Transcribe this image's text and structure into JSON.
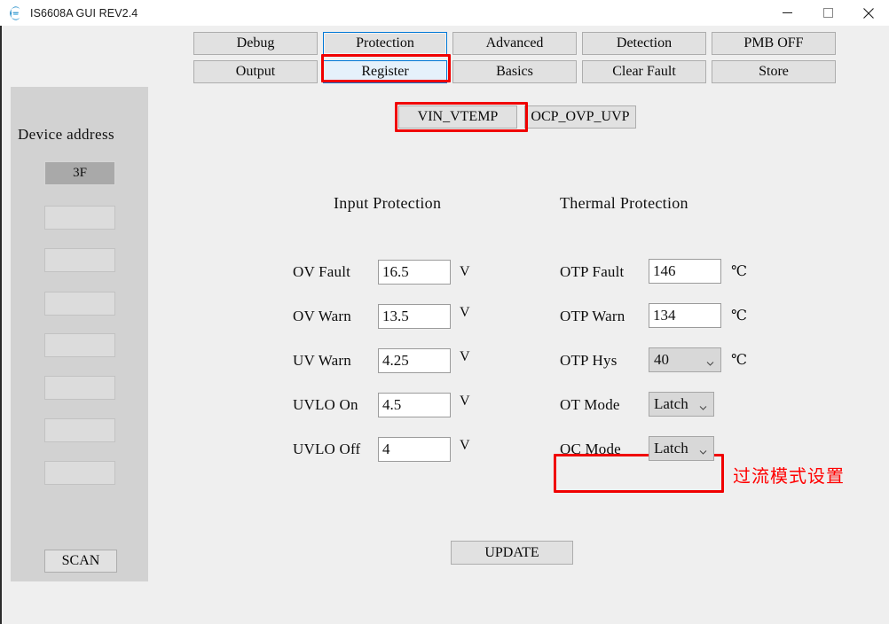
{
  "window": {
    "title": "IS6608A GUI REV2.4",
    "icon": "app-logo-icon",
    "minimize_label": "—",
    "maximize_label": "□",
    "close_label": "✕"
  },
  "nav": {
    "buttons": [
      {
        "label": "Debug",
        "state": "normal"
      },
      {
        "label": "Protection",
        "state": "focused"
      },
      {
        "label": "Advanced",
        "state": "normal"
      },
      {
        "label": "Detection",
        "state": "normal"
      },
      {
        "label": "PMB OFF",
        "state": "normal"
      },
      {
        "label": "Output",
        "state": "normal"
      },
      {
        "label": "Register",
        "state": "hover"
      },
      {
        "label": "Basics",
        "state": "normal"
      },
      {
        "label": "Clear Fault",
        "state": "normal"
      },
      {
        "label": "Store",
        "state": "normal"
      }
    ]
  },
  "subtabs": [
    {
      "label": "VIN_VTEMP",
      "selected": true
    },
    {
      "label": "OCP_OVP_UVP",
      "selected": false
    }
  ],
  "sidebar": {
    "title": "Device address",
    "slots": [
      {
        "label": "3F",
        "selected": true
      },
      {
        "label": "",
        "selected": false
      },
      {
        "label": "",
        "selected": false
      },
      {
        "label": "",
        "selected": false
      },
      {
        "label": "",
        "selected": false
      },
      {
        "label": "",
        "selected": false
      },
      {
        "label": "",
        "selected": false
      },
      {
        "label": "",
        "selected": false
      }
    ],
    "scan_label": "SCAN"
  },
  "input_protection": {
    "title": "Input Protection",
    "rows": [
      {
        "label": "OV Fault",
        "value": "16.5",
        "unit": "V"
      },
      {
        "label": "OV Warn",
        "value": "13.5",
        "unit": "V"
      },
      {
        "label": "UV Warn",
        "value": "4.25",
        "unit": "V"
      },
      {
        "label": "UVLO On",
        "value": "4.5",
        "unit": "V"
      },
      {
        "label": "UVLO Off",
        "value": "4",
        "unit": "V"
      }
    ]
  },
  "thermal_protection": {
    "title": "Thermal Protection",
    "rows": [
      {
        "label": "OTP Fault",
        "value": "146",
        "unit": "℃",
        "type": "text"
      },
      {
        "label": "OTP Warn",
        "value": "134",
        "unit": "℃",
        "type": "text"
      },
      {
        "label": "OTP Hys",
        "value": "40",
        "unit": "℃",
        "type": "select"
      },
      {
        "label": "OT Mode",
        "value": "Latch",
        "unit": "",
        "type": "select"
      },
      {
        "label": "OC Mode",
        "value": "Latch",
        "unit": "",
        "type": "select"
      }
    ]
  },
  "annotation": {
    "note": "过流模式设置",
    "color": "#ff0000",
    "boxes": [
      "Protection",
      "VIN_VTEMP",
      "OC Mode"
    ]
  },
  "update_button": {
    "label": "UPDATE"
  },
  "colors": {
    "window_bg": "#efefef",
    "panel_bg": "#d2d2d2",
    "button_face": "#e1e1e1",
    "accent_blue": "#0078d7",
    "hover_blue": "#e5f1fb",
    "annotation_red": "#ff0000",
    "selected_slot": "#a9a9a9"
  }
}
